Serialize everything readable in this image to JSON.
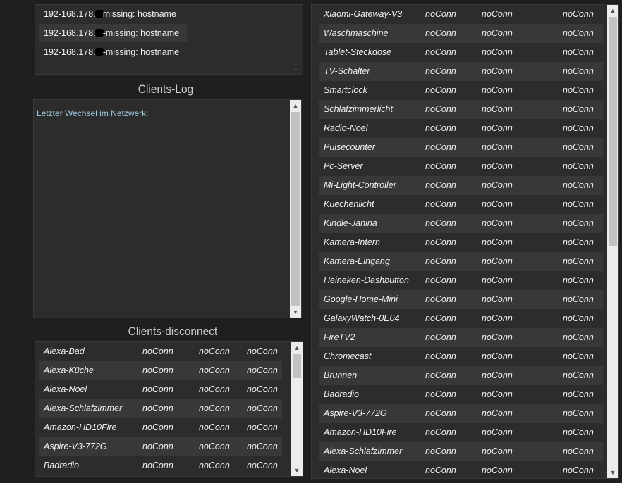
{
  "hosts": [
    {
      "pre": "192-168.178.",
      "post": "missing: hostname"
    },
    {
      "pre": "192-168.178.",
      "post": "-missing: hostname"
    },
    {
      "pre": "192-168.178.",
      "post": "-missing: hostname"
    }
  ],
  "clients_log": {
    "title": "Clients-Log",
    "text": "Letzter Wechsel im Netzwerk:"
  },
  "clients_disconnect": {
    "title": "Clients-disconnect",
    "rows": [
      {
        "name": "Alexa-Bad",
        "c1": "noConn",
        "c2": "noConn",
        "c3": "noConn"
      },
      {
        "name": "Alexa-Küche",
        "c1": "noConn",
        "c2": "noConn",
        "c3": "noConn"
      },
      {
        "name": "Alexa-Noel",
        "c1": "noConn",
        "c2": "noConn",
        "c3": "noConn"
      },
      {
        "name": "Alexa-Schlafzimmer",
        "c1": "noConn",
        "c2": "noConn",
        "c3": "noConn"
      },
      {
        "name": "Amazon-HD10Fire",
        "c1": "noConn",
        "c2": "noConn",
        "c3": "noConn"
      },
      {
        "name": "Aspire-V3-772G",
        "c1": "noConn",
        "c2": "noConn",
        "c3": "noConn"
      },
      {
        "name": "Badradio",
        "c1": "noConn",
        "c2": "noConn",
        "c3": "noConn"
      }
    ]
  },
  "right_list": {
    "rows": [
      {
        "name": "Xiaomi-Gateway-V3",
        "c1": "noConn",
        "c2": "noConn",
        "c3": "noConn"
      },
      {
        "name": "Waschmaschine",
        "c1": "noConn",
        "c2": "noConn",
        "c3": "noConn"
      },
      {
        "name": "Tablet-Steckdose",
        "c1": "noConn",
        "c2": "noConn",
        "c3": "noConn"
      },
      {
        "name": "TV-Schalter",
        "c1": "noConn",
        "c2": "noConn",
        "c3": "noConn"
      },
      {
        "name": "Smartclock",
        "c1": "noConn",
        "c2": "noConn",
        "c3": "noConn"
      },
      {
        "name": "Schlafzimmerlicht",
        "c1": "noConn",
        "c2": "noConn",
        "c3": "noConn"
      },
      {
        "name": "Radio-Noel",
        "c1": "noConn",
        "c2": "noConn",
        "c3": "noConn"
      },
      {
        "name": "Pulsecounter",
        "c1": "noConn",
        "c2": "noConn",
        "c3": "noConn"
      },
      {
        "name": "Pc-Server",
        "c1": "noConn",
        "c2": "noConn",
        "c3": "noConn"
      },
      {
        "name": "Mi-Light-Controller",
        "c1": "noConn",
        "c2": "noConn",
        "c3": "noConn"
      },
      {
        "name": "Kuechenlicht",
        "c1": "noConn",
        "c2": "noConn",
        "c3": "noConn"
      },
      {
        "name": "Kindle-Janina",
        "c1": "noConn",
        "c2": "noConn",
        "c3": "noConn"
      },
      {
        "name": "Kamera-Intern",
        "c1": "noConn",
        "c2": "noConn",
        "c3": "noConn"
      },
      {
        "name": "Kamera-Eingang",
        "c1": "noConn",
        "c2": "noConn",
        "c3": "noConn"
      },
      {
        "name": "Heineken-Dashbutton",
        "c1": "noConn",
        "c2": "noConn",
        "c3": "noConn"
      },
      {
        "name": "Google-Home-Mini",
        "c1": "noConn",
        "c2": "noConn",
        "c3": "noConn"
      },
      {
        "name": "GalaxyWatch-0E04",
        "c1": "noConn",
        "c2": "noConn",
        "c3": "noConn"
      },
      {
        "name": "FireTV2",
        "c1": "noConn",
        "c2": "noConn",
        "c3": "noConn"
      },
      {
        "name": "Chromecast",
        "c1": "noConn",
        "c2": "noConn",
        "c3": "noConn"
      },
      {
        "name": "Brunnen",
        "c1": "noConn",
        "c2": "noConn",
        "c3": "noConn"
      },
      {
        "name": "Badradio",
        "c1": "noConn",
        "c2": "noConn",
        "c3": "noConn"
      },
      {
        "name": "Aspire-V3-772G",
        "c1": "noConn",
        "c2": "noConn",
        "c3": "noConn"
      },
      {
        "name": "Amazon-HD10Fire",
        "c1": "noConn",
        "c2": "noConn",
        "c3": "noConn"
      },
      {
        "name": "Alexa-Schlafzimmer",
        "c1": "noConn",
        "c2": "noConn",
        "c3": "noConn"
      },
      {
        "name": "Alexa-Noel",
        "c1": "noConn",
        "c2": "noConn",
        "c3": "noConn"
      }
    ]
  },
  "icons": {
    "scroll_up": "scroll-up-arrow-icon",
    "scroll_down": "scroll-down-arrow-icon"
  }
}
